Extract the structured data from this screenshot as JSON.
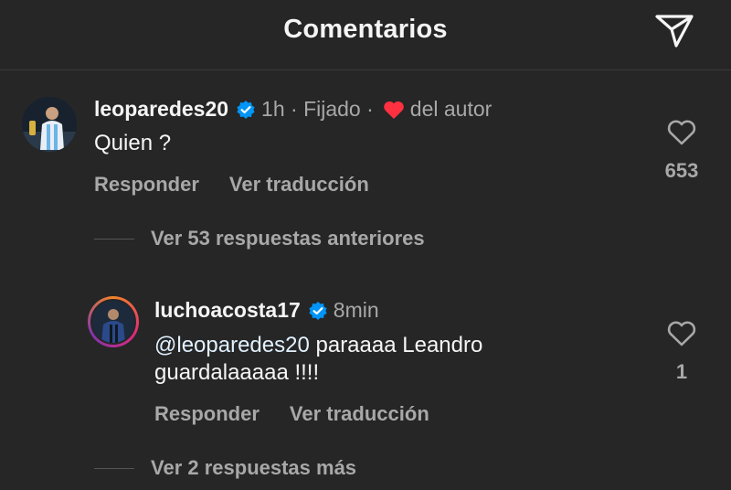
{
  "header": {
    "title": "Comentarios"
  },
  "comment": {
    "username": "leoparedes20",
    "time": "1h",
    "pinned": "Fijado",
    "author_like_label": "del autor",
    "text": "Quien ?",
    "reply_label": "Responder",
    "translate_label": "Ver traducción",
    "likes": "653"
  },
  "view_previous": {
    "label": "Ver 53 respuestas anteriores"
  },
  "reply": {
    "username": "luchoacosta17",
    "time": "8min",
    "mention": "@leoparedes20",
    "text_rest": " paraaaa Leandro guardalaaaaa !!!!",
    "reply_label": "Responder",
    "translate_label": "Ver traducción",
    "likes": "1"
  },
  "view_more": {
    "label": "Ver 2 respuestas más"
  },
  "colors": {
    "background": "#262626",
    "verified": "#0095f6",
    "heart": "#ff3040",
    "muted": "#a8a8a8"
  }
}
